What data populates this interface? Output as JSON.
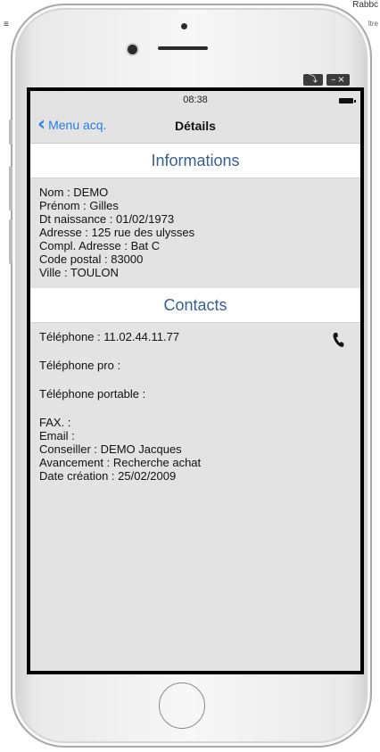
{
  "background": {
    "top_right_text": "Rabbc",
    "top_right_subtext": "ltre",
    "menu_glyph": "≡"
  },
  "window_controls": {
    "restore": "⤵",
    "minimize": "–",
    "close": "×"
  },
  "status_bar": {
    "time": "08:38"
  },
  "nav": {
    "back_label": "Menu acq.",
    "title": "Détails"
  },
  "informations": {
    "header": "Informations",
    "lines": [
      "Nom : DEMO",
      "Prénom :  Gilles",
      "Dt naissance : 01/02/1973",
      "Adresse : 125 rue des ulysses",
      "Compl. Adresse : Bat C",
      "Code postal : 83000",
      "Ville : TOULON"
    ]
  },
  "contacts": {
    "header": "Contacts",
    "telephone": "Téléphone :  11.02.44.11.77",
    "telephone_pro": "Téléphone pro :",
    "telephone_portable": "Téléphone portable :",
    "fax": "FAX. :",
    "email": "Email :",
    "conseiller": "Conseiller : DEMO Jacques",
    "avancement": "Avancement : Recherche achat",
    "date_creation": "Date création : 25/02/2009"
  },
  "icons": {
    "phone_call": "phone-icon",
    "back": "chevron-left-icon"
  },
  "colors": {
    "accent": "#2a7de1",
    "section_title": "#3a5f8a",
    "screen_bg": "#e3e3e3"
  }
}
